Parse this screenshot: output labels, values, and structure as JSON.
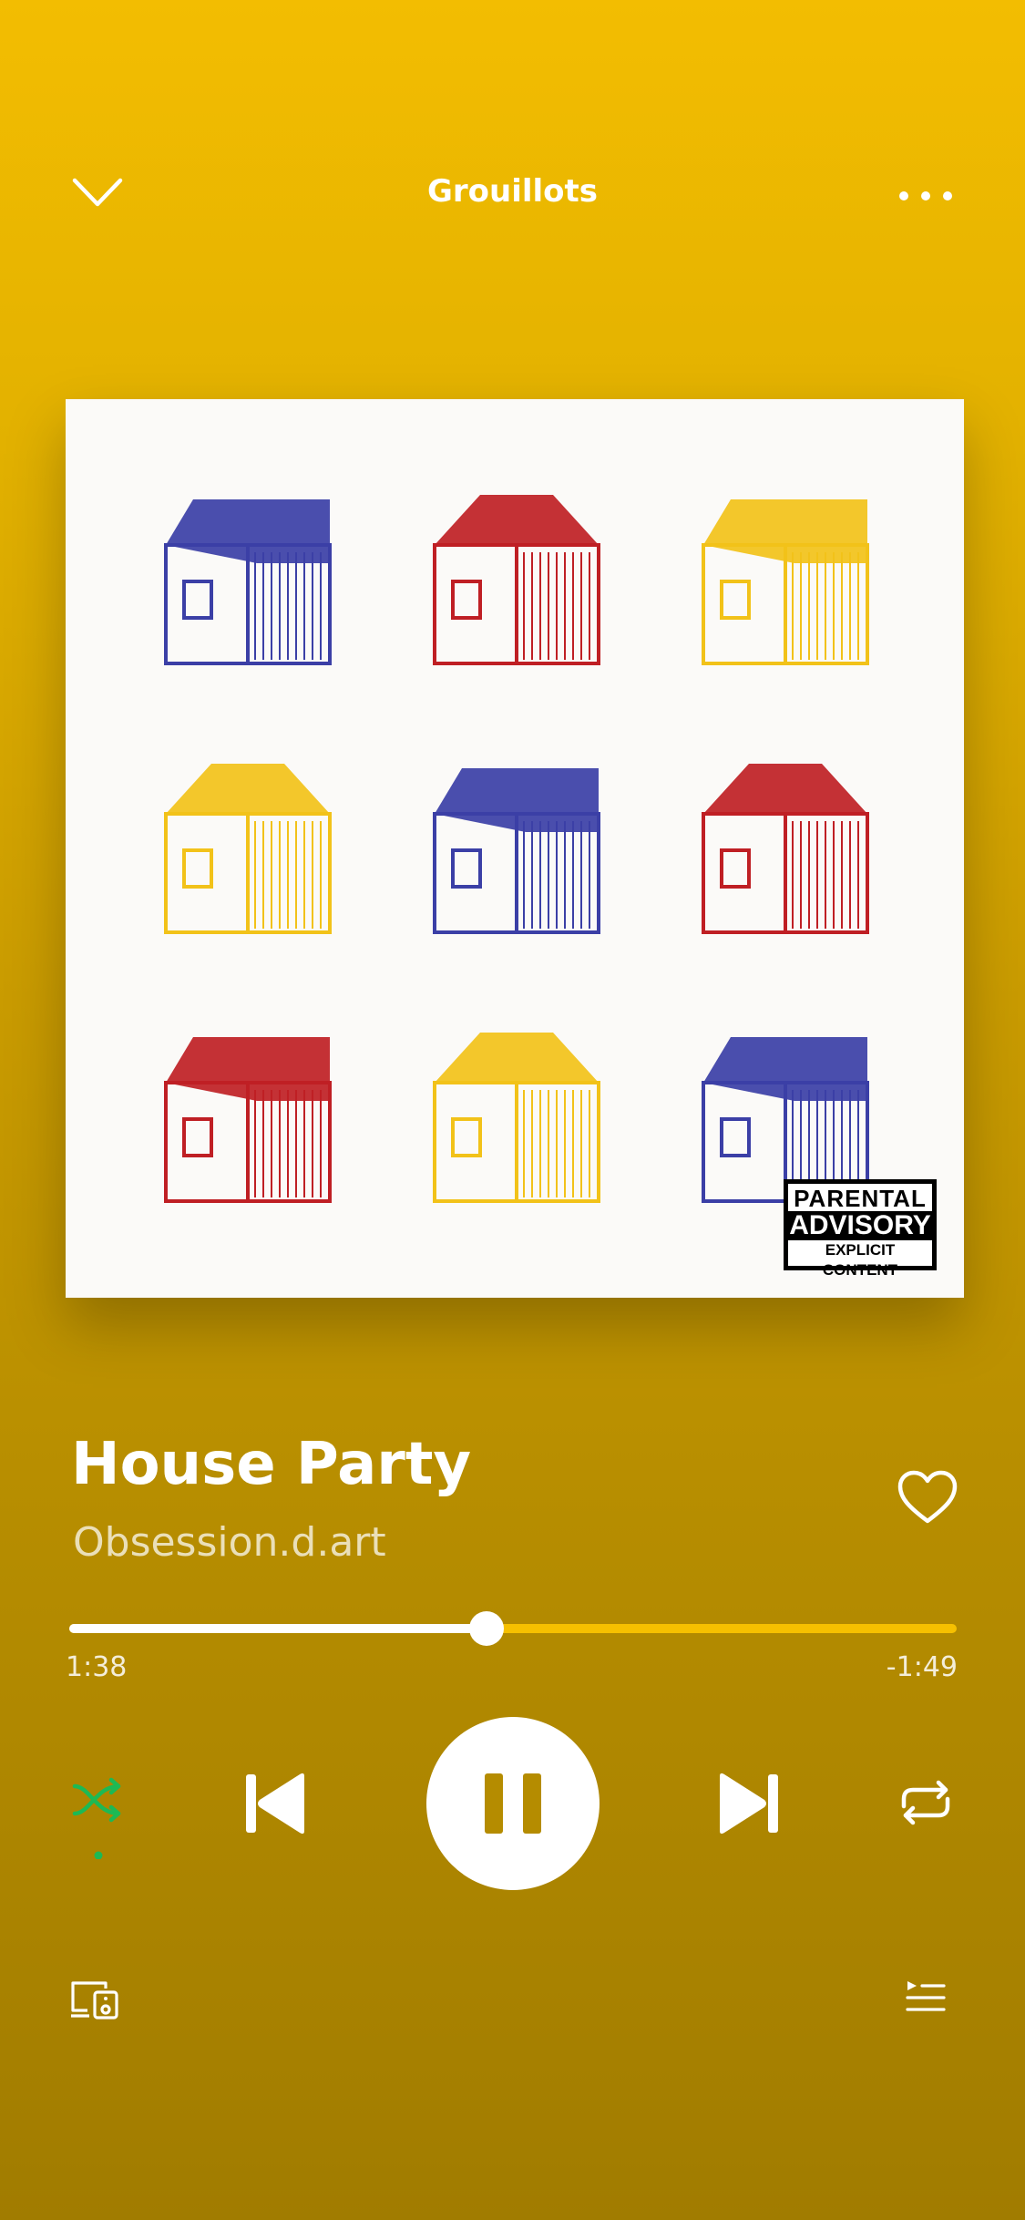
{
  "header": {
    "title": "Grouillots",
    "collapse_icon": "chevron-down-icon",
    "more_icon": "more-dots-icon"
  },
  "album_art": {
    "houses": [
      {
        "color": "#3b3fa6"
      },
      {
        "color": "#bf1f24"
      },
      {
        "color": "#f2c219"
      },
      {
        "color": "#f2c219"
      },
      {
        "color": "#3b3fa6"
      },
      {
        "color": "#bf1f24"
      },
      {
        "color": "#bf1f24"
      },
      {
        "color": "#f2c219"
      },
      {
        "color": "#3b3fa6"
      }
    ],
    "advisory": {
      "line1": "PARENTAL",
      "line2": "ADVISORY",
      "line3": "EXPLICIT CONTENT"
    }
  },
  "track": {
    "title": "House Party",
    "artist": "Obsession.d.art"
  },
  "playback": {
    "elapsed": "1:38",
    "remaining": "-1:49",
    "progress": 0.47
  },
  "controls": {
    "shuffle_icon": "shuffle-icon",
    "shuffle_active": true,
    "prev_icon": "skip-previous-icon",
    "play_pause_icon": "pause-icon",
    "next_icon": "skip-next-icon",
    "repeat_icon": "repeat-icon",
    "like_icon": "heart-outline-icon"
  },
  "footer": {
    "devices_icon": "devices-icon",
    "queue_icon": "queue-icon"
  },
  "colors": {
    "accent_green": "#1db954",
    "bar_yellow": "#f6c000"
  }
}
